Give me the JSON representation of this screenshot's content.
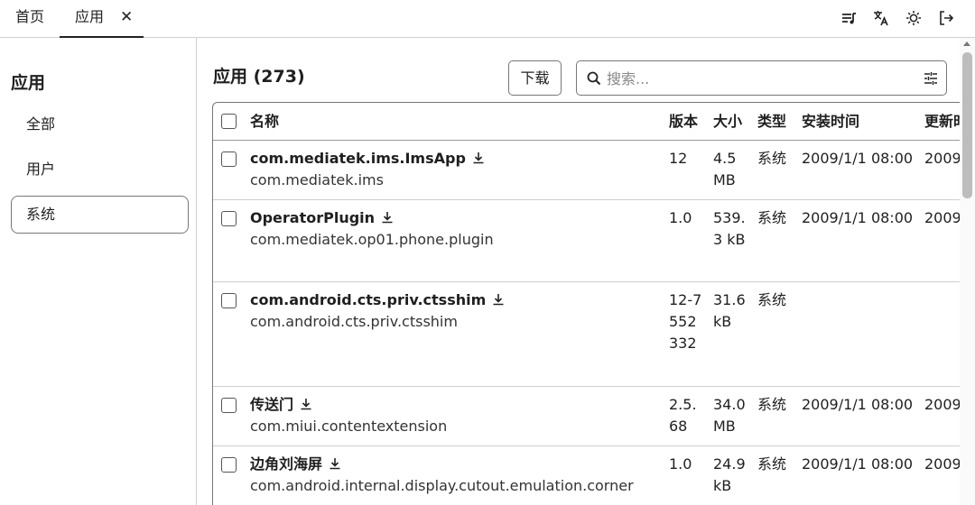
{
  "topbar": {
    "tabs": [
      {
        "label": "首页"
      },
      {
        "label": "应用"
      }
    ],
    "close_glyph": "✕",
    "icons": [
      "queue-music-icon",
      "translate-icon",
      "brightness-icon",
      "logout-icon"
    ]
  },
  "sidebar": {
    "title": "应用",
    "items": [
      {
        "label": "全部"
      },
      {
        "label": "用户"
      },
      {
        "label": "系统"
      }
    ],
    "active_index": 2
  },
  "main": {
    "title": "应用 (273)",
    "download_label": "下载",
    "search": {
      "placeholder": "搜索...",
      "value": ""
    }
  },
  "table": {
    "columns": [
      "名称",
      "版本",
      "大小",
      "类型",
      "安装时间",
      "更新时间"
    ],
    "rows": [
      {
        "name": "com.mediatek.ims.ImsApp",
        "package": "com.mediatek.ims",
        "version": "12",
        "size": "4.5 MB",
        "type": "系统",
        "installed": "2009/1/1 08:00",
        "updated": "2009"
      },
      {
        "name": "OperatorPlugin",
        "package": "com.mediatek.op01.phone.plugin",
        "version": "1.0",
        "size": "539.3 kB",
        "type": "系统",
        "installed": "2009/1/1 08:00",
        "updated": "2009"
      },
      {
        "name": "com.android.cts.priv.ctsshim",
        "package": "com.android.cts.priv.ctsshim",
        "version": "12-7552332",
        "size": "31.6 kB",
        "type": "系统",
        "installed": "",
        "updated": ""
      },
      {
        "name": "传送门",
        "package": "com.miui.contentextension",
        "version": "2.5.68",
        "size": "34.0 MB",
        "type": "系统",
        "installed": "2009/1/1 08:00",
        "updated": "2009"
      },
      {
        "name": "边角刘海屏",
        "package": "com.android.internal.display.cutout.emulation.corner",
        "version": "1.0",
        "size": "24.9 kB",
        "type": "系统",
        "installed": "2009/1/1 08:00",
        "updated": "2009"
      }
    ]
  },
  "colors": {
    "text": "#1f1f1f",
    "border": "#777777",
    "divider": "#cfcfcf"
  }
}
